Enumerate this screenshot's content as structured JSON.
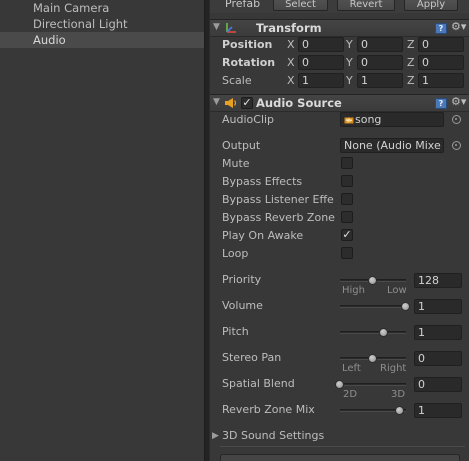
{
  "hierarchy": {
    "items": [
      {
        "label": "Main Camera",
        "selected": false
      },
      {
        "label": "Directional Light",
        "selected": false
      },
      {
        "label": "Audio",
        "selected": true
      }
    ]
  },
  "prefab": {
    "label": "Prefab",
    "select": "Select",
    "revert": "Revert",
    "apply": "Apply"
  },
  "transform": {
    "title": "Transform",
    "rows": [
      {
        "label": "Position",
        "x": "0",
        "y": "0",
        "z": "0"
      },
      {
        "label": "Rotation",
        "x": "0",
        "y": "0",
        "z": "0"
      },
      {
        "label": "Scale",
        "x": "1",
        "y": "1",
        "z": "1"
      }
    ],
    "axes": {
      "x": "X",
      "y": "Y",
      "z": "Z"
    }
  },
  "audio_source": {
    "title": "Audio Source",
    "enabled": true,
    "audio_clip": {
      "label": "AudioClip",
      "value": "song"
    },
    "output": {
      "label": "Output",
      "value": "None (Audio Mixe"
    },
    "toggles": [
      {
        "label": "Mute",
        "checked": false
      },
      {
        "label": "Bypass Effects",
        "checked": false
      },
      {
        "label": "Bypass Listener Effe",
        "checked": false
      },
      {
        "label": "Bypass Reverb Zone",
        "checked": false
      },
      {
        "label": "Play On Awake",
        "checked": true
      },
      {
        "label": "Loop",
        "checked": false
      }
    ],
    "sliders": [
      {
        "label": "Priority",
        "value": "128",
        "level": 0.5,
        "min_label": "High",
        "max_label": "Low"
      },
      {
        "label": "Volume",
        "value": "1",
        "level": 1.0,
        "min_label": "",
        "max_label": ""
      },
      {
        "label": "Pitch",
        "value": "1",
        "level": 0.67,
        "min_label": "",
        "max_label": ""
      },
      {
        "label": "Stereo Pan",
        "value": "0",
        "level": 0.5,
        "min_label": "Left",
        "max_label": "Right"
      },
      {
        "label": "Spatial Blend",
        "value": "0",
        "level": 0.0,
        "min_label": "2D",
        "max_label": "3D"
      },
      {
        "label": "Reverb Zone Mix",
        "value": "1",
        "level": 0.91,
        "min_label": "",
        "max_label": ""
      }
    ],
    "sound_settings": {
      "label": "3D Sound Settings"
    }
  },
  "icons": {
    "help": "?",
    "gear": "⚙▾",
    "checkmark": "✓",
    "foldout_open": "▼",
    "foldout_closed": "▶"
  }
}
